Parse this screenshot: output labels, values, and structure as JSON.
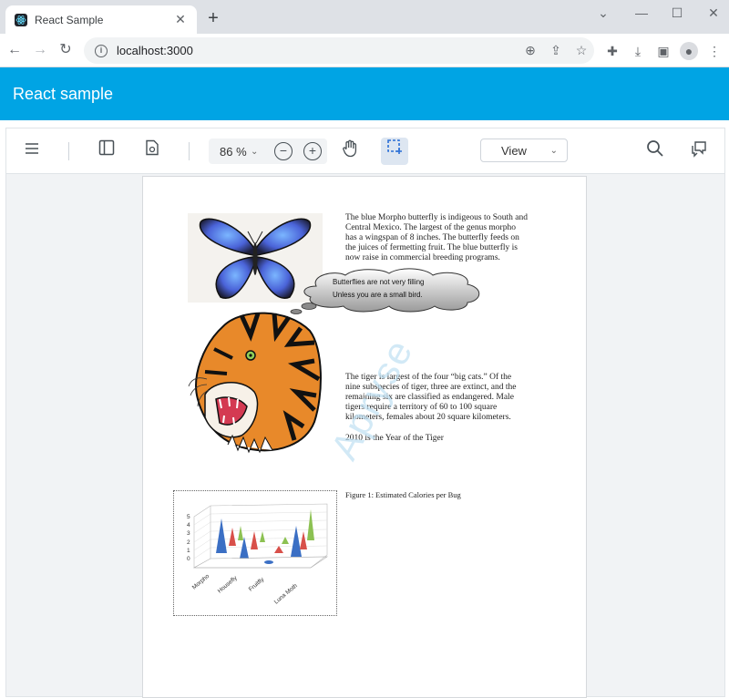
{
  "browser": {
    "tab_title": "React Sample",
    "tab_close": "✕",
    "new_tab": "+",
    "url": "localhost:3000",
    "icons": [
      "back-icon",
      "forward-icon",
      "reload-icon",
      "info-icon",
      "zoom-icon",
      "share-icon",
      "star-icon",
      "extensions-icon",
      "download-icon",
      "sidepanel-icon",
      "profile-icon",
      "menu-icon"
    ]
  },
  "app": {
    "title": "React sample",
    "accent": "#00a4e4"
  },
  "viewer": {
    "zoom_value": "86 %",
    "view_label": "View"
  },
  "document": {
    "butterfly_text": "The blue Morpho butterfly is indigeous to South and Central Mexico.  The largest of the genus morpho has a wingspan of 8 inches. The butterfly feeds on the juices of fermetting fruit.  The blue butterfly is now raise in commercial breeding programs.",
    "bubble_line1": "Butterflies are not very filling",
    "bubble_line2": "Unless you are a small bird.",
    "tiger_text": "The tiger is largest of the four “big cats.” Of the nine subspecies of tiger, three are extinct, and the remaining six are classified as endangered. Male tigers require a territory of 60 to 100 square kilometers, females about 20 square kilometers.",
    "tiger_year": "2010 is the Year of the Tiger",
    "figure_caption": "Figure 1: Estimated Calories per Bug",
    "chart_yticks": [
      "5",
      "4",
      "3",
      "2",
      "1",
      "0"
    ],
    "chart_categories": [
      "Morpho",
      "Housefly",
      "Fruitfly",
      "Luna Moth"
    ],
    "watermark": "Apryse"
  }
}
